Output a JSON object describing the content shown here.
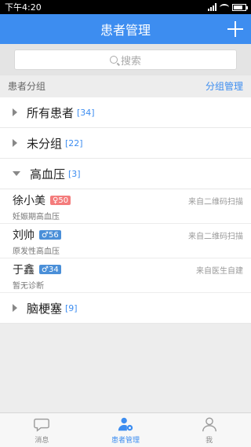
{
  "status": {
    "time": "下午4:20"
  },
  "header": {
    "title": "患者管理"
  },
  "search": {
    "placeholder": "搜索"
  },
  "section": {
    "label": "患者分组",
    "action": "分组管理"
  },
  "groups": [
    {
      "name": "所有患者",
      "count": "[34]"
    },
    {
      "name": "未分组",
      "count": "[22]"
    },
    {
      "name": "高血压",
      "count": "[3]"
    },
    {
      "name": "脑梗塞",
      "count": "[9]"
    }
  ],
  "patients": [
    {
      "name": "徐小美",
      "gender_icon": "female-icon",
      "gender_symbol": "♀",
      "age": "50",
      "source": "来自二维码扫描",
      "diagnosis": "妊娠期高血压"
    },
    {
      "name": "刘帅",
      "gender_icon": "male-icon",
      "gender_symbol": "♂",
      "age": "56",
      "source": "来自二维码扫描",
      "diagnosis": "原发性高血压"
    },
    {
      "name": "于鑫",
      "gender_icon": "male-icon",
      "gender_symbol": "♂",
      "age": "34",
      "source": "来自医生自建",
      "diagnosis": "暂无诊断"
    }
  ],
  "tabs": [
    {
      "label": "消息",
      "icon": "chat-bubble-icon"
    },
    {
      "label": "患者管理",
      "icon": "patient-gear-icon"
    },
    {
      "label": "我",
      "icon": "person-icon"
    }
  ],
  "colors": {
    "primary": "#3d8df0",
    "female_badge": "#f47c7c",
    "male_badge": "#4a8fd8"
  }
}
